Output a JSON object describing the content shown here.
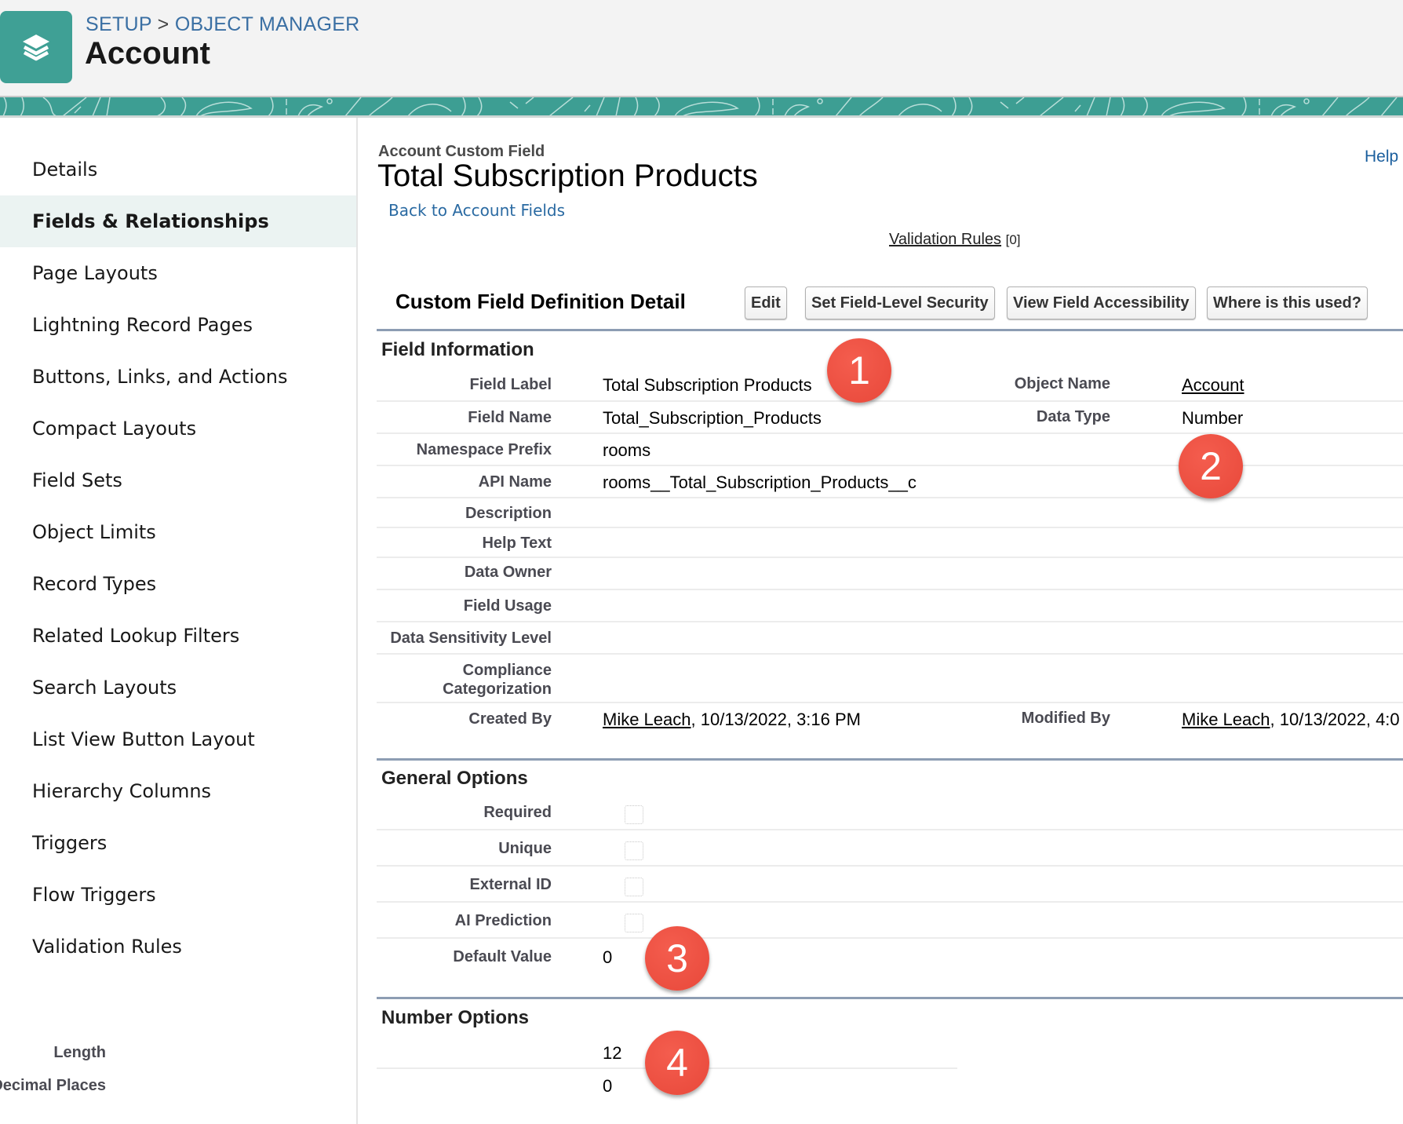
{
  "header": {
    "breadcrumb": [
      {
        "label": "SETUP"
      },
      {
        "separator": ">"
      },
      {
        "label": "OBJECT MANAGER"
      }
    ],
    "object_title": "Account",
    "object_icon": "layers-icon",
    "accent_color": "#3fa095"
  },
  "sidebar": {
    "items": [
      {
        "label": "Details",
        "active": false
      },
      {
        "label": "Fields & Relationships",
        "active": true
      },
      {
        "label": "Page Layouts",
        "active": false
      },
      {
        "label": "Lightning Record Pages",
        "active": false
      },
      {
        "label": "Buttons, Links, and Actions",
        "active": false
      },
      {
        "label": "Compact Layouts",
        "active": false
      },
      {
        "label": "Field Sets",
        "active": false
      },
      {
        "label": "Object Limits",
        "active": false
      },
      {
        "label": "Record Types",
        "active": false
      },
      {
        "label": "Related Lookup Filters",
        "active": false
      },
      {
        "label": "Search Layouts",
        "active": false
      },
      {
        "label": "List View Button Layout",
        "active": false
      },
      {
        "label": "Hierarchy Columns",
        "active": false
      },
      {
        "label": "Triggers",
        "active": false
      },
      {
        "label": "Flow Triggers",
        "active": false
      },
      {
        "label": "Validation Rules",
        "active": false
      }
    ]
  },
  "main": {
    "eyebrow": "Account Custom Field",
    "title": "Total Subscription Products",
    "back_link": "Back to Account Fields",
    "help_link": "Help",
    "validation_rules": {
      "label": "Validation Rules",
      "count": "[0]"
    },
    "section_title": "Custom Field Definition Detail",
    "buttons": [
      {
        "label": "Edit"
      },
      {
        "label": "Set Field-Level Security"
      },
      {
        "label": "View Field Accessibility"
      },
      {
        "label": "Where is this used?"
      }
    ],
    "field_information": {
      "heading": "Field Information",
      "rows": [
        {
          "label": "Field Label",
          "value": "Total Subscription Products",
          "label2": "Object Name",
          "value2": "Account"
        },
        {
          "label": "Field Name",
          "value": "Total_Subscription_Products",
          "label2": "Data Type",
          "value2": "Number"
        },
        {
          "label": "Namespace Prefix",
          "value": "rooms"
        },
        {
          "label": "API Name",
          "value": "rooms__Total_Subscription_Products__c"
        },
        {
          "label": "Description",
          "value": ""
        },
        {
          "label": "Help Text",
          "value": ""
        },
        {
          "label": "Data Owner",
          "value": ""
        },
        {
          "label": "Field Usage",
          "value": ""
        },
        {
          "label": "Data Sensitivity Level",
          "value": ""
        },
        {
          "label": "Compliance Categorization",
          "value": ""
        }
      ],
      "created_by": {
        "label": "Created By",
        "user": "Mike Leach",
        "timestamp": ", 10/13/2022, 3:16 PM"
      },
      "modified_by": {
        "label": "Modified By",
        "user": "Mike Leach",
        "timestamp": ", 10/13/2022, 4:0"
      }
    },
    "general_options": {
      "heading": "General Options",
      "checkboxes": [
        {
          "label": "Required",
          "checked": false
        },
        {
          "label": "Unique",
          "checked": false
        },
        {
          "label": "External ID",
          "checked": false
        },
        {
          "label": "AI Prediction",
          "checked": false
        }
      ],
      "default_value": {
        "label": "Default Value",
        "value": "0"
      }
    },
    "number_options": {
      "heading": "Number Options",
      "rows": [
        {
          "label": "Length",
          "value": "12"
        },
        {
          "label": "Decimal Places",
          "value": "0"
        }
      ]
    }
  },
  "annotations": [
    {
      "number": "1",
      "color": "#ec4d3f"
    },
    {
      "number": "2",
      "color": "#ec4d3f"
    },
    {
      "number": "3",
      "color": "#ec4d3f"
    },
    {
      "number": "4",
      "color": "#ec4d3f"
    }
  ]
}
